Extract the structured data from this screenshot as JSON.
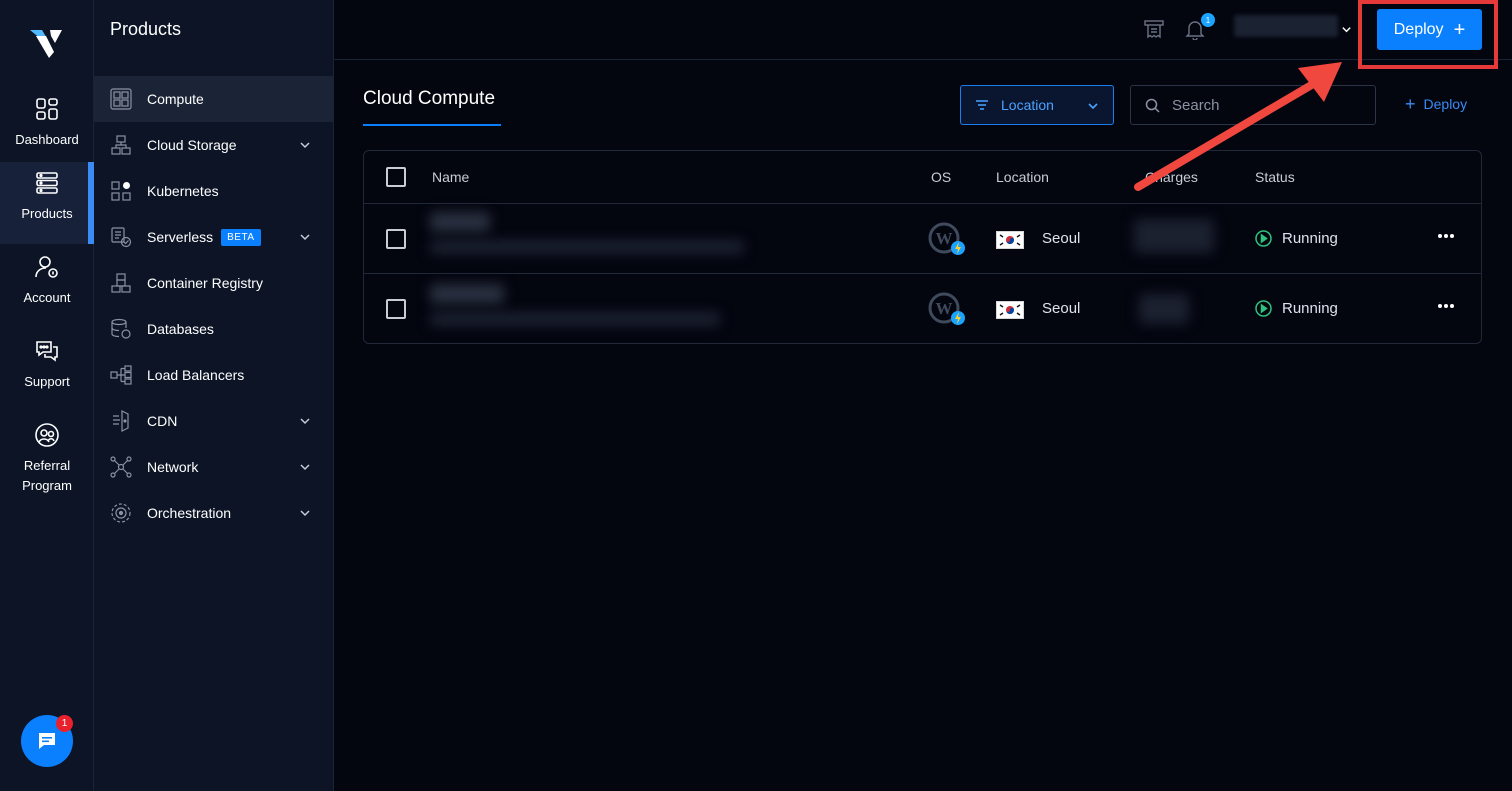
{
  "rail": {
    "items": [
      {
        "label": "Dashboard",
        "icon": "dashboard-icon"
      },
      {
        "label": "Products",
        "icon": "products-icon",
        "active": true
      },
      {
        "label": "Account",
        "icon": "account-icon"
      },
      {
        "label": "Support",
        "icon": "support-icon"
      },
      {
        "label": "Referral Program",
        "icon": "referral-icon"
      }
    ],
    "chat_badge": "1"
  },
  "sidebar": {
    "title": "Products",
    "items": [
      {
        "label": "Compute",
        "icon": "compute-icon",
        "active": true
      },
      {
        "label": "Cloud Storage",
        "icon": "cloud-storage-icon",
        "expandable": true
      },
      {
        "label": "Kubernetes",
        "icon": "kubernetes-icon"
      },
      {
        "label": "Serverless",
        "icon": "serverless-icon",
        "badge": "BETA",
        "expandable": true
      },
      {
        "label": "Container Registry",
        "icon": "container-registry-icon"
      },
      {
        "label": "Databases",
        "icon": "databases-icon"
      },
      {
        "label": "Load Balancers",
        "icon": "load-balancers-icon"
      },
      {
        "label": "CDN",
        "icon": "cdn-icon",
        "expandable": true
      },
      {
        "label": "Network",
        "icon": "network-icon",
        "expandable": true
      },
      {
        "label": "Orchestration",
        "icon": "orchestration-icon",
        "expandable": true
      }
    ]
  },
  "topbar": {
    "notification_count": "1",
    "deploy_label": "Deploy",
    "deploy_plus": "+"
  },
  "main": {
    "title": "Cloud Compute",
    "location_filter": "Location",
    "search_placeholder": "Search",
    "deploy_link": "Deploy",
    "deploy_link_plus": "+"
  },
  "table": {
    "headers": {
      "name": "Name",
      "os": "OS",
      "location": "Location",
      "charges": "Charges",
      "status": "Status"
    },
    "rows": [
      {
        "os_icon": "wordpress-icon",
        "location": "Seoul",
        "status": "Running"
      },
      {
        "os_icon": "wordpress-icon",
        "location": "Seoul",
        "status": "Running"
      }
    ]
  },
  "colors": {
    "accent": "#0b80ff",
    "running": "#2ec27e",
    "highlight": "#e63a3a"
  }
}
